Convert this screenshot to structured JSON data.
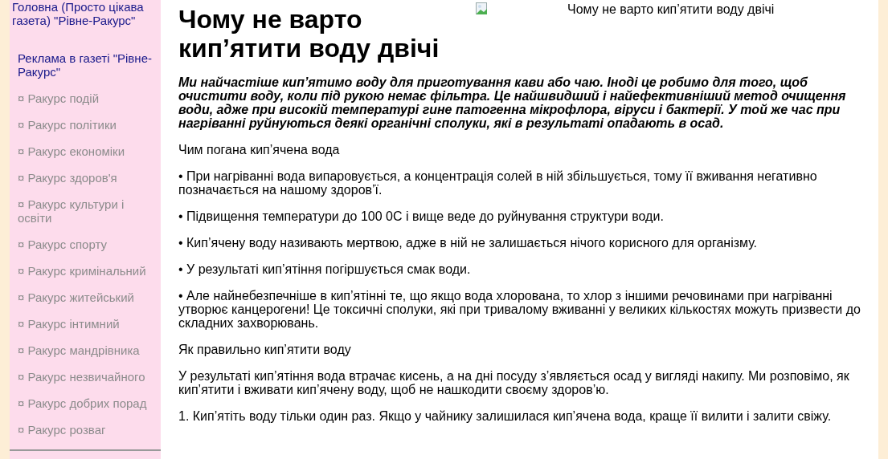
{
  "sidebar": {
    "links": [
      {
        "label": "Головна (Просто цікава газета) \"Рівне-Ракурс\"",
        "kind": "primary"
      },
      {
        "label": "Реклама в газеті \"Рівне-Ракурс\"",
        "kind": "primary"
      },
      {
        "label": "¤ Ракурс подій",
        "kind": "section"
      },
      {
        "label": "¤ Ракурс політики",
        "kind": "section"
      },
      {
        "label": "¤ Ракурс економіки",
        "kind": "section"
      },
      {
        "label": "¤ Ракурс здоров'я",
        "kind": "section"
      },
      {
        "label": "¤ Ракурс культури і освіти",
        "kind": "section"
      },
      {
        "label": "¤ Ракурс спорту",
        "kind": "section"
      },
      {
        "label": "¤ Ракурс кримінальний",
        "kind": "section"
      },
      {
        "label": "¤ Ракурс житейський",
        "kind": "section"
      },
      {
        "label": "¤ Ракурс інтимний",
        "kind": "section"
      },
      {
        "label": "¤ Ракурс мандрівника",
        "kind": "section"
      },
      {
        "label": "¤ Ракурс незвичайного",
        "kind": "section"
      },
      {
        "label": "¤ Ракурс добрих порад",
        "kind": "section"
      },
      {
        "label": "¤ Ракурс розваг",
        "kind": "section"
      }
    ]
  },
  "article": {
    "title": "Чому не варто кип’ятити воду двічі",
    "image_alt": "Чому не варто кип’ятити воду двічі",
    "paragraphs": [
      {
        "kind": "lead",
        "text": "Ми найчастіше кип’ятимо воду для приготування кави або чаю. Іноді це робимо для того, щоб очистити воду, коли під рукою немає фільтра. Це найшвидший і найефективніший метод очищення води, адже при високій температурі гине патогенна мікрофлора, віруси і бактерії. У той же час при нагріванні руйнуються деякі органічні сполуки, які в результаті опадають в осад."
      },
      {
        "kind": "text",
        "text": "Чим погана кип’ячена вода"
      },
      {
        "kind": "text",
        "text": "• При нагріванні вода випаровується, а концентрація солей в ній збільшується, тому її вживання негативно позначається на нашому здоров’ї."
      },
      {
        "kind": "text",
        "text": "• Підвищення температури до 100 0С і вище веде до руйнування структури води."
      },
      {
        "kind": "text",
        "text": "• Кип’ячену воду називають мертвою, адже в ній не залишається нічого корисного для організму."
      },
      {
        "kind": "text",
        "text": "• У результаті кип’ятіння погіршується смак води."
      },
      {
        "kind": "text",
        "text": "• Але найнебезпечніше в кип’ятінні те, що якщо вода хлорована, то хлор з іншими речовинами при нагріванні утворює канцерогени! Це токсичні сполуки, які при тривалому вживанні у великих кількостях можуть призвести до складних захворювань."
      },
      {
        "kind": "text",
        "text": "Як правильно кип’ятити воду"
      },
      {
        "kind": "text",
        "text": "У результаті кип’ятіння вода втрачає кисень, а на дні посуду з’являється осад у вигляді накипу. Ми розповімо, як кип’ятити і вживати кип’ячену воду, щоб не нашкодити своєму здоров’ю."
      },
      {
        "kind": "text",
        "text": "1. Кип’ятіть воду тільки один раз. Якщо у чайнику залишилася кип’ячена вода, краще її вилити і залити свіжу."
      }
    ]
  }
}
